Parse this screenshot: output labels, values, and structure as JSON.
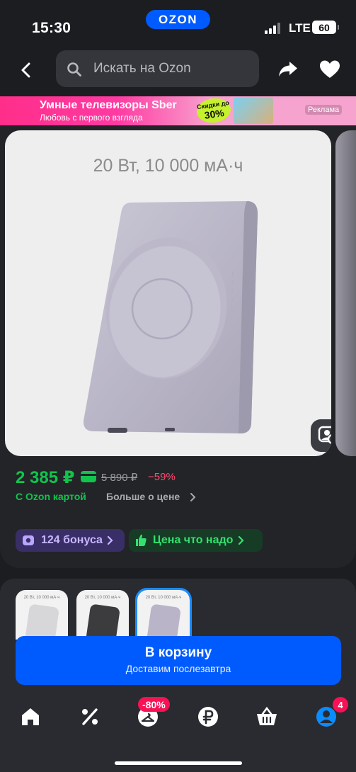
{
  "status_bar": {
    "time": "15:30",
    "network": "LTE",
    "battery": "60",
    "app_badge": "OZON"
  },
  "header": {
    "search_placeholder": "Искать на Ozon"
  },
  "banner": {
    "title": "Умные телевизоры Sber",
    "subtitle": "Любовь с первого взгляда",
    "discount_prefix": "Скидки до",
    "discount_value": "30%",
    "ad_label": "Реклама"
  },
  "product": {
    "image_caption": "20 Вт, 10 000 мА·ч",
    "price": "2 385 ₽",
    "old_price": "5 890 ₽",
    "discount": "−59%",
    "card_price_label": "С Ozon картой",
    "more_about_price": "Больше о цене"
  },
  "chips": {
    "bonus": "124 бонуса",
    "good_price": "Цена что надо"
  },
  "variants": [
    {
      "label": "20 Вт, 10 000 мА·ч",
      "color": "#d7d7d9",
      "selected": false
    },
    {
      "label": "20 Вт, 10 000 мА·ч",
      "color": "#3c3c3e",
      "selected": false
    },
    {
      "label": "20 Вт, 10 000 мА·ч",
      "color": "#b9b4c8",
      "selected": true
    }
  ],
  "cart_button": {
    "label": "В корзину",
    "sublabel": "Доставим послезавтра"
  },
  "tabbar": {
    "promo_badge": "-80%",
    "profile_badge": "4"
  },
  "colors": {
    "accent": "#005bff",
    "price_green": "#10c44c",
    "discount_red": "#ff4d6d",
    "badge_pink": "#f91155"
  }
}
